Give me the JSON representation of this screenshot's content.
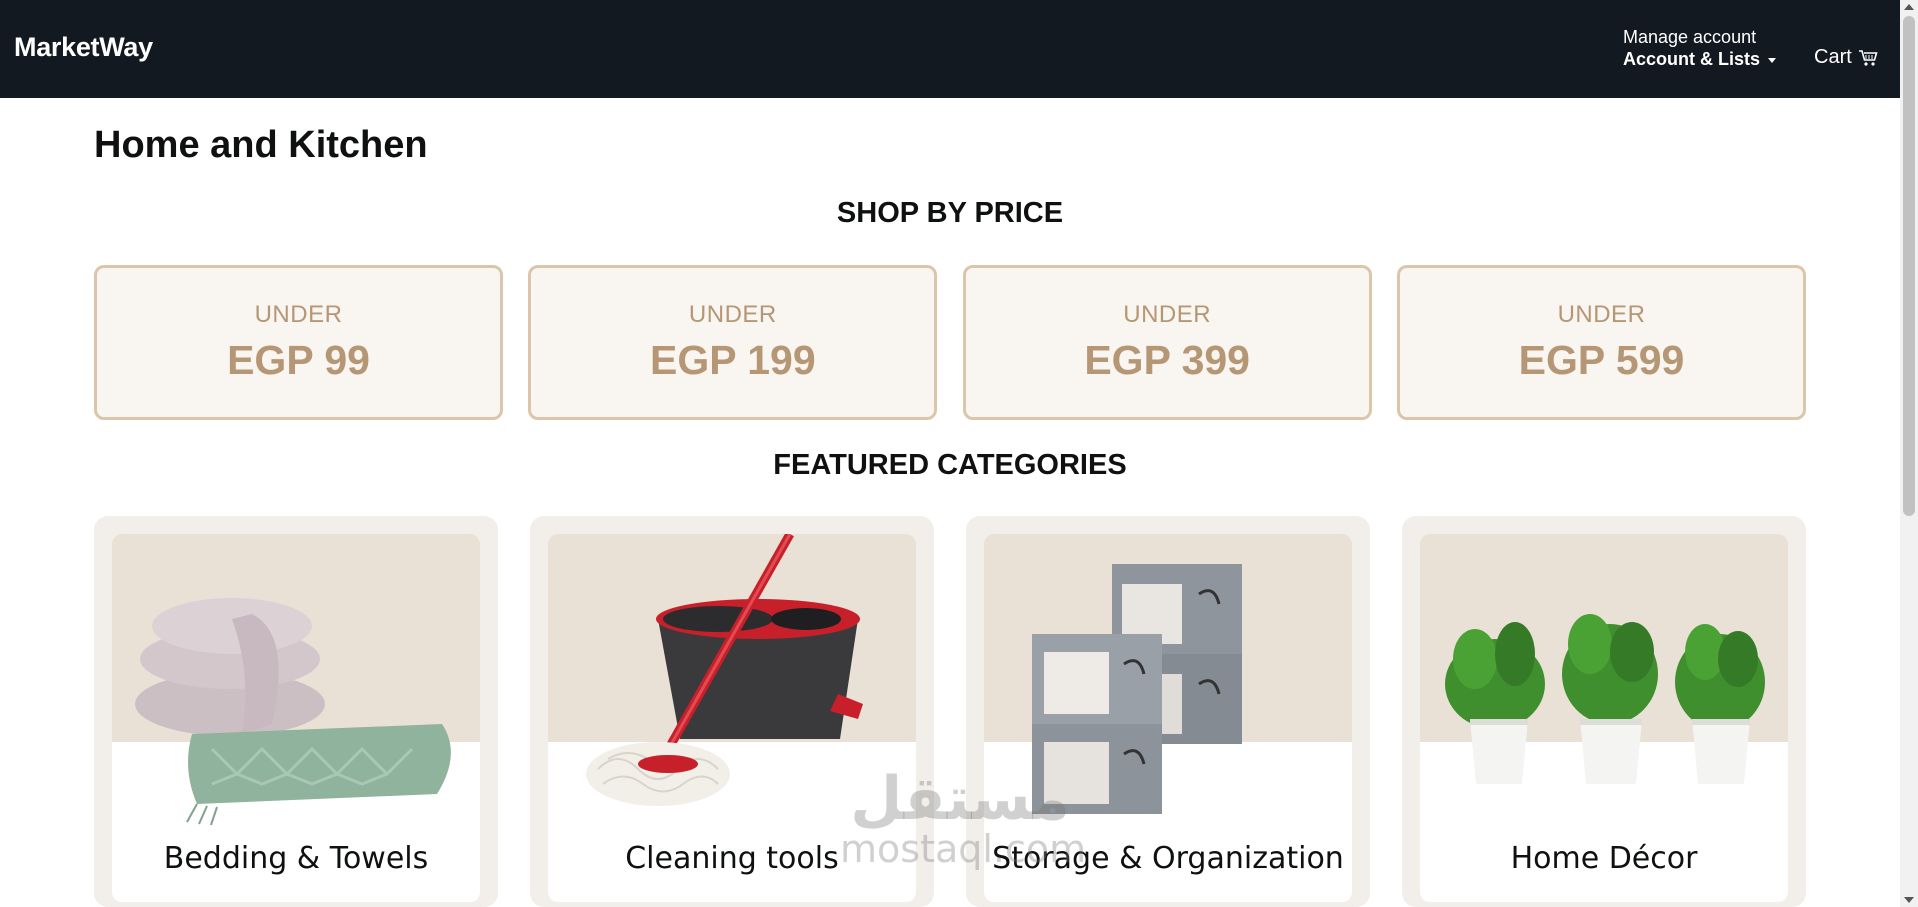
{
  "header": {
    "logo": "MarketWay",
    "account_small": "Manage account",
    "account_big": "Account & Lists",
    "cart_label": "Cart"
  },
  "page": {
    "title": "Home and Kitchen"
  },
  "shop_by_price": {
    "title": "SHOP BY PRICE",
    "cards": [
      {
        "under": "UNDER",
        "amount": "EGP 99"
      },
      {
        "under": "UNDER",
        "amount": "EGP 199"
      },
      {
        "under": "UNDER",
        "amount": "EGP 399"
      },
      {
        "under": "UNDER",
        "amount": "EGP 599"
      }
    ]
  },
  "featured": {
    "title": "FEATURED CATEGORIES",
    "categories": [
      {
        "label": "Bedding & Towels",
        "icon": "pillows-towel-image"
      },
      {
        "label": "Cleaning tools",
        "icon": "spin-mop-bucket-image"
      },
      {
        "label": "Storage & Organization",
        "icon": "storage-boxes-image"
      },
      {
        "label": "Home Décor",
        "icon": "potted-plants-image"
      }
    ]
  },
  "watermark": {
    "arabic": "مستقل",
    "latin": "mostaql.com"
  },
  "colors": {
    "topbar": "#131921",
    "price_accent": "#b69775",
    "price_bg": "#f9f5f0",
    "price_border": "#dcc6ab",
    "category_card_bg": "#f2eee9",
    "category_image_bg": "#e9e1d5"
  }
}
